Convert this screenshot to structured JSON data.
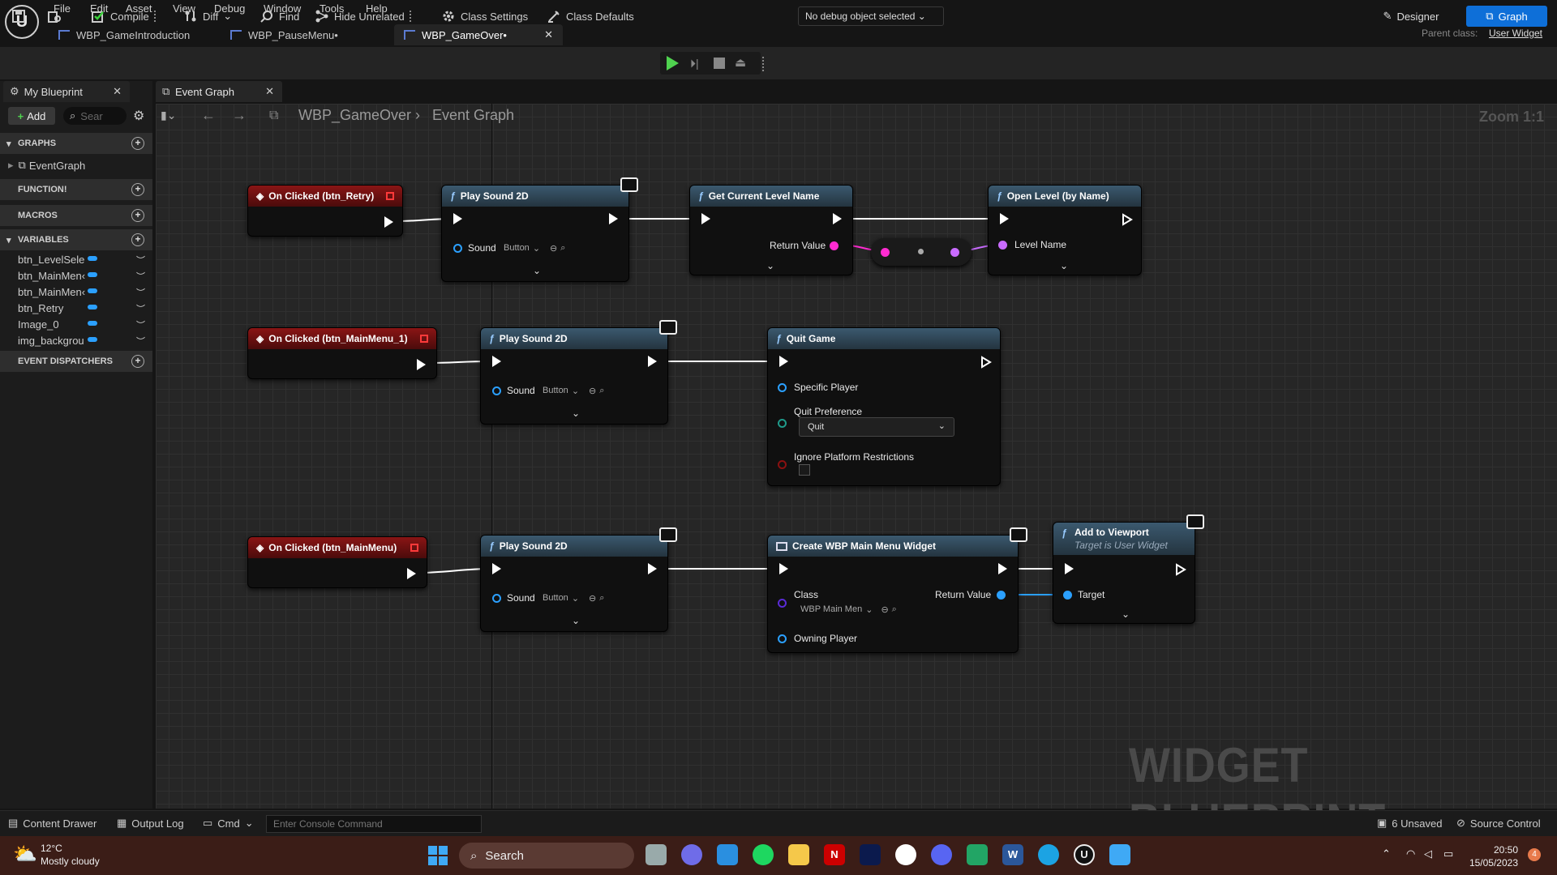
{
  "menu": [
    "File",
    "Edit",
    "Asset",
    "View",
    "Debug",
    "Window",
    "Tools",
    "Help"
  ],
  "tabs": [
    {
      "label": "WBP_GameIntroduction"
    },
    {
      "label": "WBP_PauseMenu•"
    },
    {
      "label": "WBP_GameOver•"
    }
  ],
  "parent_class": {
    "label": "Parent class:",
    "value": "User Widget"
  },
  "toolbar": {
    "compile": "Compile",
    "diff": "Diff",
    "find": "Find",
    "hide_unrelated": "Hide Unrelated",
    "class_settings": "Class Settings",
    "class_defaults": "Class Defaults",
    "debug_object": "No debug object selected",
    "designer": "Designer",
    "graph": "Graph"
  },
  "my_blueprint": {
    "tab": "My Blueprint",
    "add": "Add",
    "search_placeholder": "Sear",
    "graphs_header": "GRAPHS",
    "event_graph": "EventGraph",
    "functions_header": "FUNCTION!",
    "macros_header": "MACROS",
    "variables_header": "VARIABLES",
    "variables": [
      "btn_LevelSele",
      "btn_MainMen‹",
      "btn_MainMen‹",
      "btn_Retry",
      "Image_0",
      "img_backgrou"
    ],
    "dispatchers_header": "EVENT DISPATCHERS"
  },
  "graph_tab": "Event Graph",
  "breadcrumb": {
    "blueprint": "WBP_GameOver",
    "graph": "Event Graph"
  },
  "zoom": "Zoom 1:1",
  "watermark": "WIDGET BLUEPRINT",
  "nodes": {
    "ev_retry": "On Clicked (btn_Retry)",
    "ev_mainmenu1": "On Clicked (btn_MainMenu_1)",
    "ev_mainmenu": "On Clicked (btn_MainMenu)",
    "play_sound": "Play Sound 2D",
    "sound": "Sound",
    "sound_value": "Button",
    "get_level": "Get Current Level Name",
    "return_value": "Return Value",
    "open_level": "Open Level (by Name)",
    "level_name": "Level Name",
    "quit_game": "Quit Game",
    "specific_player": "Specific Player",
    "quit_pref": "Quit Preference",
    "quit_value": "Quit",
    "ignore_platform": "Ignore Platform Restrictions",
    "create_widget": "Create WBP Main Menu Widget",
    "class": "Class",
    "class_value": "WBP Main Men",
    "owning_player": "Owning Player",
    "add_viewport": "Add to Viewport",
    "target_is": "Target is User Widget",
    "target": "Target"
  },
  "bottom": {
    "content_drawer": "Content Drawer",
    "output_log": "Output Log",
    "cmd": "Cmd",
    "console_placeholder": "Enter Console Command",
    "unsaved": "6 Unsaved",
    "source_control": "Source Control"
  },
  "taskbar": {
    "temp": "12°C",
    "weather": "Mostly cloudy",
    "search": "Search",
    "time": "20:50",
    "date": "15/05/2023",
    "badge": "4"
  },
  "colors": {
    "accent": "#0e6fd8",
    "event_red": "#8a1515",
    "function_blue": "#3b596f",
    "string_pin": "#ff2bd1",
    "name_pin": "#c96bff",
    "object_pin": "#2ba0ff"
  }
}
